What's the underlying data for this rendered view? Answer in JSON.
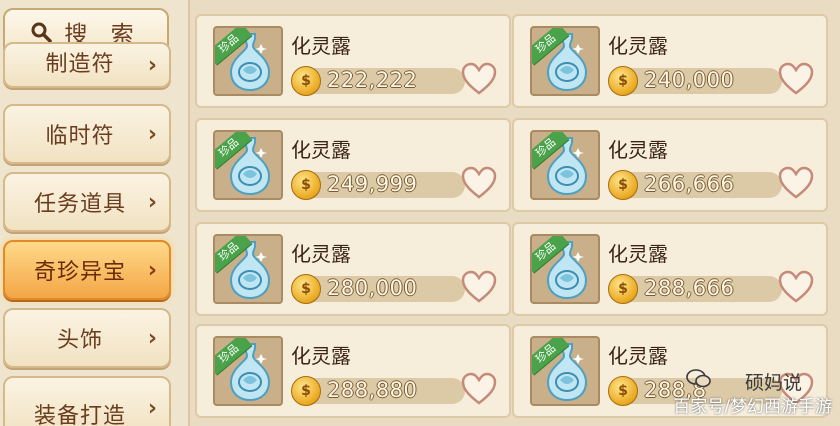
{
  "search": {
    "label": "搜 索"
  },
  "categories": [
    {
      "label": "制造符"
    },
    {
      "label": "临时符"
    },
    {
      "label": "任务道具"
    },
    {
      "label": "奇珍异宝",
      "active": true
    },
    {
      "label": "头饰"
    },
    {
      "label": "装备打造"
    }
  ],
  "items": [
    {
      "name": "化灵露",
      "badge": "珍品",
      "price": "222,222"
    },
    {
      "name": "化灵露",
      "badge": "珍品",
      "price": "240,000"
    },
    {
      "name": "化灵露",
      "badge": "珍品",
      "price": "249,999"
    },
    {
      "name": "化灵露",
      "badge": "珍品",
      "price": "266,666"
    },
    {
      "name": "化灵露",
      "badge": "珍品",
      "price": "280,000"
    },
    {
      "name": "化灵露",
      "badge": "珍品",
      "price": "288,666"
    },
    {
      "name": "化灵露",
      "badge": "珍品",
      "price": "288,880"
    },
    {
      "name": "化灵露",
      "badge": "珍品",
      "price": "288,8"
    }
  ],
  "watermark": {
    "account": "硕妈说",
    "source": "百家号/梦幻西游手游"
  },
  "colors": {
    "active_category": "#f3a646",
    "card_bg": "#f6eddb",
    "badge_green": "#4aa34a"
  },
  "icons": {
    "search": "magnifier-icon",
    "chevron": "chevron-right-icon",
    "coin": "coin-icon",
    "favorite": "heart-outline-icon",
    "item": "vase-icon"
  }
}
